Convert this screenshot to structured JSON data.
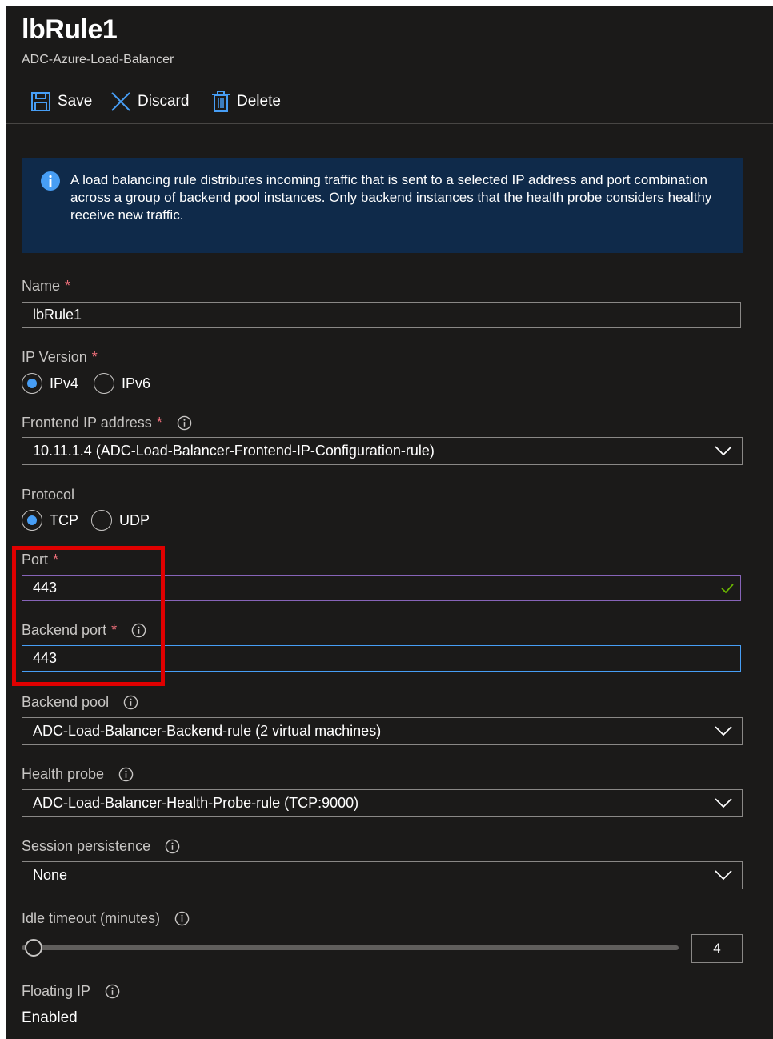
{
  "header": {
    "title": "lbRule1",
    "subtitle": "ADC-Azure-Load-Balancer"
  },
  "toolbar": {
    "save_label": "Save",
    "discard_label": "Discard",
    "delete_label": "Delete"
  },
  "info": {
    "text": "A load balancing rule distributes incoming traffic that is sent to a selected IP address and port combination across a group of backend pool instances. Only backend instances that the health probe considers healthy receive new traffic."
  },
  "form": {
    "required_marker": "*",
    "name": {
      "label": "Name",
      "value": "lbRule1"
    },
    "ip_version": {
      "label": "IP Version",
      "options": [
        "IPv4",
        "IPv6"
      ],
      "selected": "IPv4"
    },
    "frontend_ip": {
      "label": "Frontend IP address",
      "value": "10.11.1.4 (ADC-Load-Balancer-Frontend-IP-Configuration-rule)"
    },
    "protocol": {
      "label": "Protocol",
      "options": [
        "TCP",
        "UDP"
      ],
      "selected": "TCP"
    },
    "port": {
      "label": "Port",
      "value": "443"
    },
    "backend_port": {
      "label": "Backend port",
      "value": "443"
    },
    "backend_pool": {
      "label": "Backend pool",
      "value": "ADC-Load-Balancer-Backend-rule (2 virtual machines)"
    },
    "health_probe": {
      "label": "Health probe",
      "value": "ADC-Load-Balancer-Health-Probe-rule (TCP:9000)"
    },
    "session_persistence": {
      "label": "Session persistence",
      "value": "None"
    },
    "idle_timeout": {
      "label": "Idle timeout (minutes)",
      "value": "4"
    },
    "floating_ip": {
      "label": "Floating IP",
      "value": "Enabled"
    }
  },
  "colors": {
    "background": "#1b1a19",
    "info_bg": "#0f2a4a",
    "accent": "#479ef5",
    "required": "#f1707b",
    "highlight": "#e00000",
    "valid": "#6bb700"
  }
}
